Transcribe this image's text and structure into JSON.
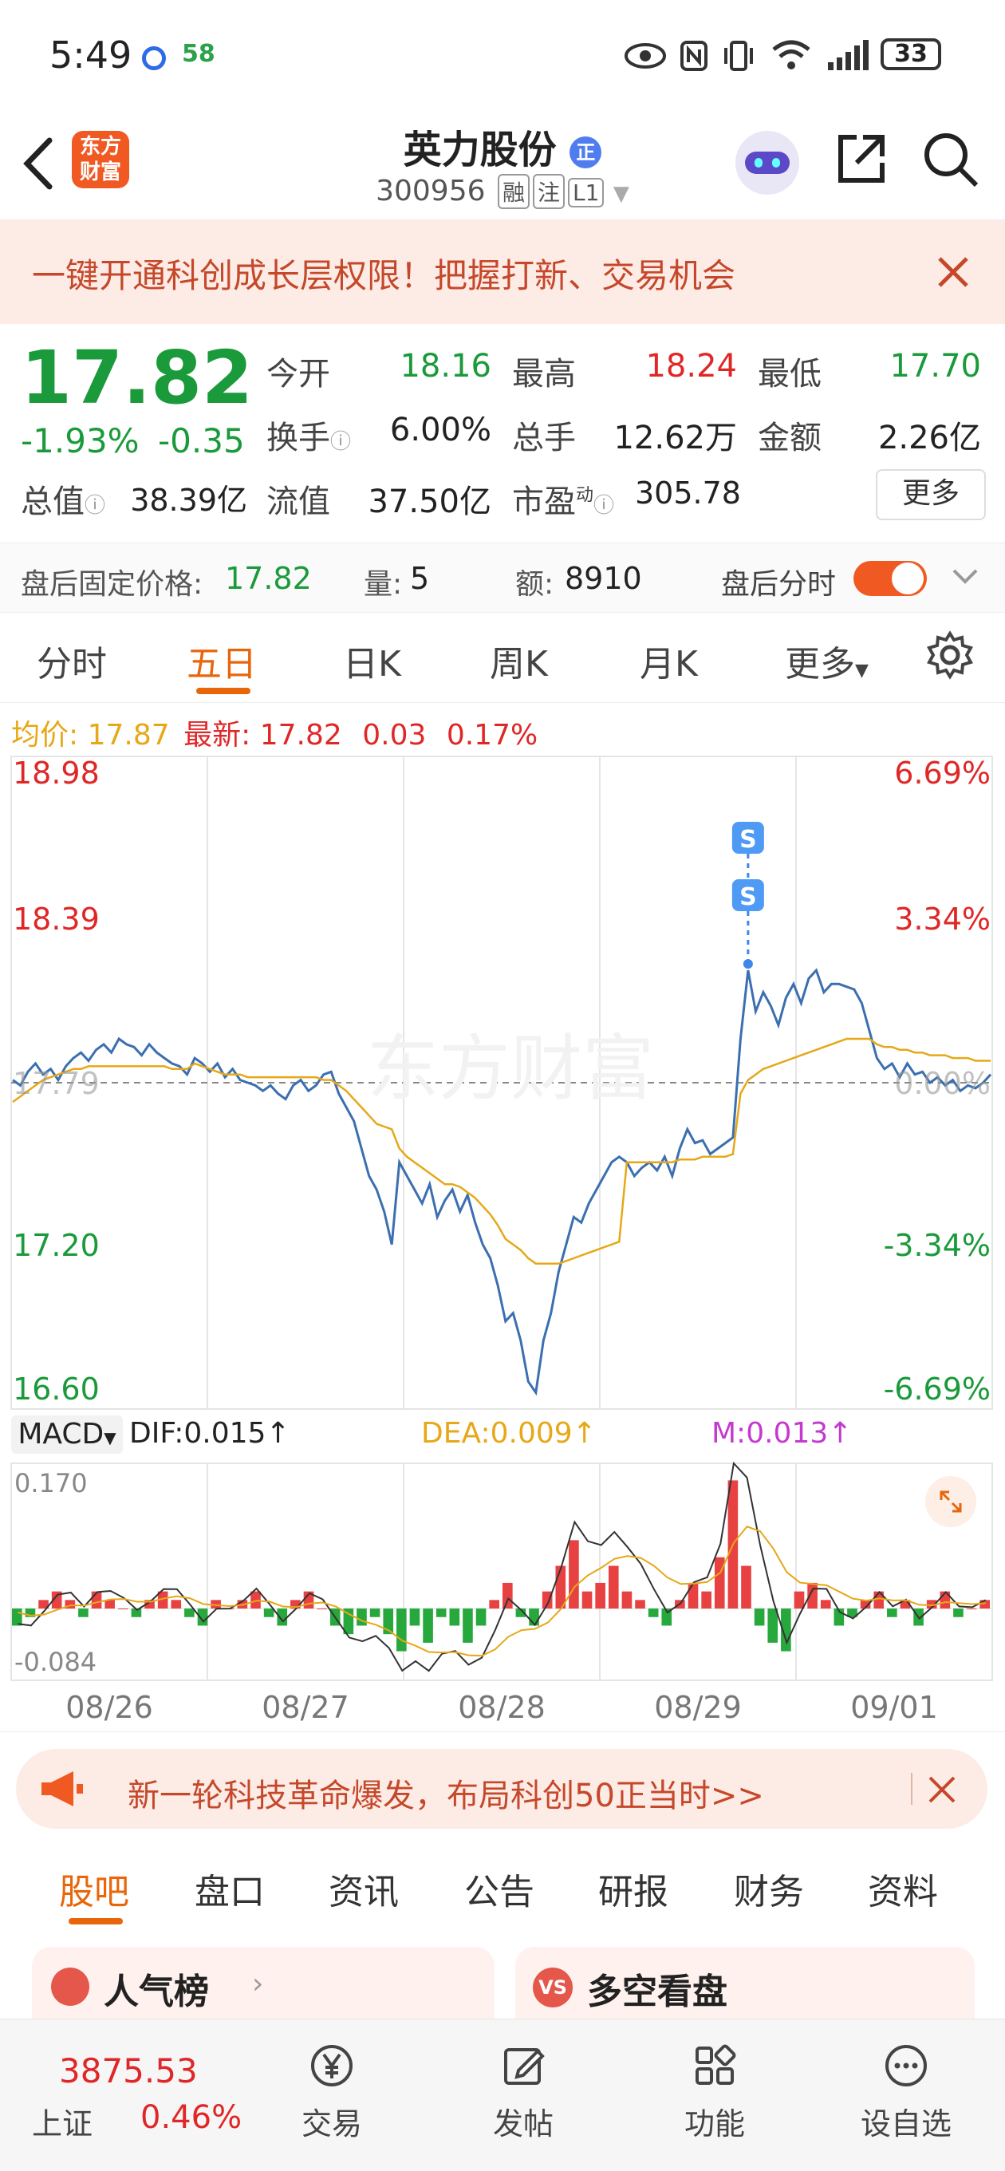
{
  "status_bar": {
    "time": "5:49",
    "app_badge": "58",
    "battery": "33"
  },
  "header": {
    "logo_line1": "东方",
    "logo_line2": "财富",
    "stock_name": "英力股份",
    "name_badge": "正",
    "stock_code": "300956",
    "tags": [
      "融",
      "注",
      "L1"
    ]
  },
  "banner": {
    "text": "一键开通科创成长层权限！把握打新、交易机会"
  },
  "quote": {
    "price": "17.82",
    "change_pct": "-1.93%",
    "change": "-0.35",
    "open_label": "今开",
    "open": "18.16",
    "high_label": "最高",
    "high": "18.24",
    "low_label": "最低",
    "low": "17.70",
    "turnover_label": "换手",
    "turnover": "6.00%",
    "volume_label": "总手",
    "volume": "12.62万",
    "amount_label": "金额",
    "amount": "2.26亿",
    "mktcap_label": "总值",
    "mktcap": "38.39亿",
    "float_label": "流值",
    "float": "37.50亿",
    "pe_label": "市盈",
    "pe_sup": "动",
    "pe": "305.78",
    "more_label": "更多"
  },
  "after_hours": {
    "price_label": "盘后固定价格:",
    "price": "17.82",
    "vol_label": "量:",
    "vol": "5",
    "amt_label": "额:",
    "amt": "8910",
    "toggle_label": "盘后分时"
  },
  "chart_tabs": [
    "分时",
    "五日",
    "日K",
    "周K",
    "月K",
    "更多"
  ],
  "chart_legend": {
    "avg_label": "均价:",
    "avg": "17.87",
    "latest_label": "最新:",
    "latest": "17.82",
    "change": "0.03",
    "change_pct": "0.17%"
  },
  "colors": {
    "accent": "#e8650a",
    "up": "#e02727",
    "down": "#1a9a3a",
    "price_line": "#3b6fb0",
    "avg_line": "#e6a817"
  },
  "chart_data": [
    {
      "type": "line",
      "watermark": "东方财富",
      "y_ticks_left": [
        "18.98",
        "18.39",
        "17.79",
        "17.20",
        "16.60"
      ],
      "y_ticks_right": [
        "6.69%",
        "3.34%",
        "0.00%",
        "-3.34%",
        "-6.69%"
      ],
      "ylim": [
        16.6,
        18.98
      ],
      "prev_close": 17.79,
      "days": [
        "08/26",
        "08/27",
        "08/28",
        "08/29",
        "09/01"
      ],
      "markers": [
        "S",
        "S"
      ],
      "series": [
        {
          "values": [
            17.8,
            17.78,
            17.83,
            17.86,
            17.82,
            17.84,
            17.8,
            17.85,
            17.88,
            17.9,
            17.87,
            17.91,
            17.93,
            17.9,
            17.95,
            17.93,
            17.92,
            17.89,
            17.93,
            17.9,
            17.88,
            17.86,
            17.85,
            17.82,
            17.88,
            17.86,
            17.83,
            17.86,
            17.81,
            17.84,
            17.8,
            17.79,
            17.78,
            17.76,
            17.78,
            17.75,
            17.73,
            17.78,
            17.8,
            17.76,
            17.78,
            17.82,
            17.83,
            17.75,
            17.7,
            17.65,
            17.55,
            17.45,
            17.4,
            17.32,
            17.2,
            17.5,
            17.45,
            17.4,
            17.35,
            17.42,
            17.3,
            17.36,
            17.4,
            17.32,
            17.38,
            17.28,
            17.2,
            17.15,
            17.05,
            16.92,
            16.95,
            16.85,
            16.7,
            16.66,
            16.85,
            16.95,
            17.1,
            17.2,
            17.3,
            17.28,
            17.35,
            17.4,
            17.45,
            17.5,
            17.52,
            17.5,
            17.45,
            17.48,
            17.5,
            17.47,
            17.52,
            17.45,
            17.55,
            17.62,
            17.57,
            17.58,
            17.53,
            17.55,
            17.57,
            17.59,
            17.95,
            18.2,
            18.05,
            18.12,
            18.07,
            18.0,
            18.1,
            18.15,
            18.08,
            18.17,
            18.2,
            18.12,
            18.15,
            18.15,
            18.14,
            18.13,
            18.08,
            17.98,
            17.88,
            17.84,
            17.86,
            17.81,
            17.86,
            17.82,
            17.83,
            17.79,
            17.81,
            17.78,
            17.8,
            17.76,
            17.78,
            17.77,
            17.79,
            17.82
          ]
        },
        {
          "values": [
            17.72,
            17.74,
            17.76,
            17.78,
            17.8,
            17.81,
            17.82,
            17.83,
            17.84,
            17.84,
            17.85,
            17.85,
            17.85,
            17.85,
            17.85,
            17.85,
            17.85,
            17.85,
            17.85,
            17.85,
            17.85,
            17.84,
            17.84,
            17.84,
            17.86,
            17.85,
            17.84,
            17.83,
            17.82,
            17.82,
            17.82,
            17.81,
            17.81,
            17.81,
            17.81,
            17.81,
            17.81,
            17.81,
            17.81,
            17.81,
            17.81,
            17.8,
            17.8,
            17.78,
            17.76,
            17.73,
            17.7,
            17.67,
            17.64,
            17.63,
            17.62,
            17.55,
            17.52,
            17.5,
            17.48,
            17.46,
            17.44,
            17.42,
            17.42,
            17.41,
            17.39,
            17.37,
            17.34,
            17.31,
            17.27,
            17.22,
            17.2,
            17.18,
            17.15,
            17.13,
            17.13,
            17.13,
            17.13,
            17.14,
            17.15,
            17.16,
            17.17,
            17.18,
            17.19,
            17.2,
            17.21,
            17.5,
            17.5,
            17.5,
            17.5,
            17.5,
            17.5,
            17.5,
            17.51,
            17.51,
            17.51,
            17.52,
            17.52,
            17.52,
            17.52,
            17.53,
            17.75,
            17.8,
            17.82,
            17.84,
            17.85,
            17.86,
            17.87,
            17.88,
            17.89,
            17.9,
            17.91,
            17.92,
            17.93,
            17.94,
            17.95,
            17.95,
            17.95,
            17.95,
            17.93,
            17.92,
            17.92,
            17.91,
            17.91,
            17.9,
            17.9,
            17.89,
            17.89,
            17.89,
            17.88,
            17.88,
            17.88,
            17.87,
            17.87,
            17.87
          ]
        }
      ]
    },
    {
      "type": "bar",
      "indicator": "MACD",
      "dif_label": "DIF:0.015",
      "dea_label": "DEA:0.009",
      "m_label": "M:0.013",
      "y_ticks": [
        "0.170",
        "-0.084"
      ],
      "ylim": [
        -0.084,
        0.17
      ],
      "x_ticks": [
        "08/26",
        "08/27",
        "08/28",
        "08/29",
        "09/01"
      ],
      "series": [
        {
          "values": [
            -0.02,
            -0.01,
            0.01,
            0.02,
            0.01,
            -0.01,
            0.02,
            0.01,
            0.0,
            -0.01,
            0.01,
            0.02,
            0.01,
            -0.01,
            -0.02,
            0.01,
            0.0,
            0.01,
            0.02,
            -0.01,
            -0.02,
            0.01,
            0.02,
            0.0,
            -0.02,
            -0.03,
            -0.02,
            -0.01,
            -0.03,
            -0.05,
            -0.02,
            -0.04,
            -0.01,
            -0.02,
            -0.04,
            -0.02,
            0.01,
            0.03,
            -0.01,
            -0.02,
            0.02,
            0.05,
            0.08,
            0.02,
            0.03,
            0.05,
            0.02,
            0.01,
            -0.01,
            -0.02,
            0.01,
            0.03,
            0.02,
            0.06,
            0.15,
            0.05,
            -0.02,
            -0.04,
            -0.05,
            0.02,
            0.03,
            0.01,
            -0.02,
            -0.01,
            0.01,
            0.02,
            -0.01,
            0.01,
            -0.02,
            0.01,
            0.02,
            -0.01,
            0.0,
            0.01
          ]
        }
      ]
    }
  ],
  "promo": {
    "text": "新一轮科技革命爆发，布局科创50正当时>>"
  },
  "sub_tabs": [
    "股吧",
    "盘口",
    "资讯",
    "公告",
    "研报",
    "财务",
    "资料"
  ],
  "cards": {
    "left": "人气榜",
    "right": "多空看盘"
  },
  "bottom_nav": {
    "index_value": "3875.53",
    "index_name": "上证",
    "index_change": "0.46%",
    "items": [
      "交易",
      "发帖",
      "功能",
      "设自选"
    ]
  }
}
